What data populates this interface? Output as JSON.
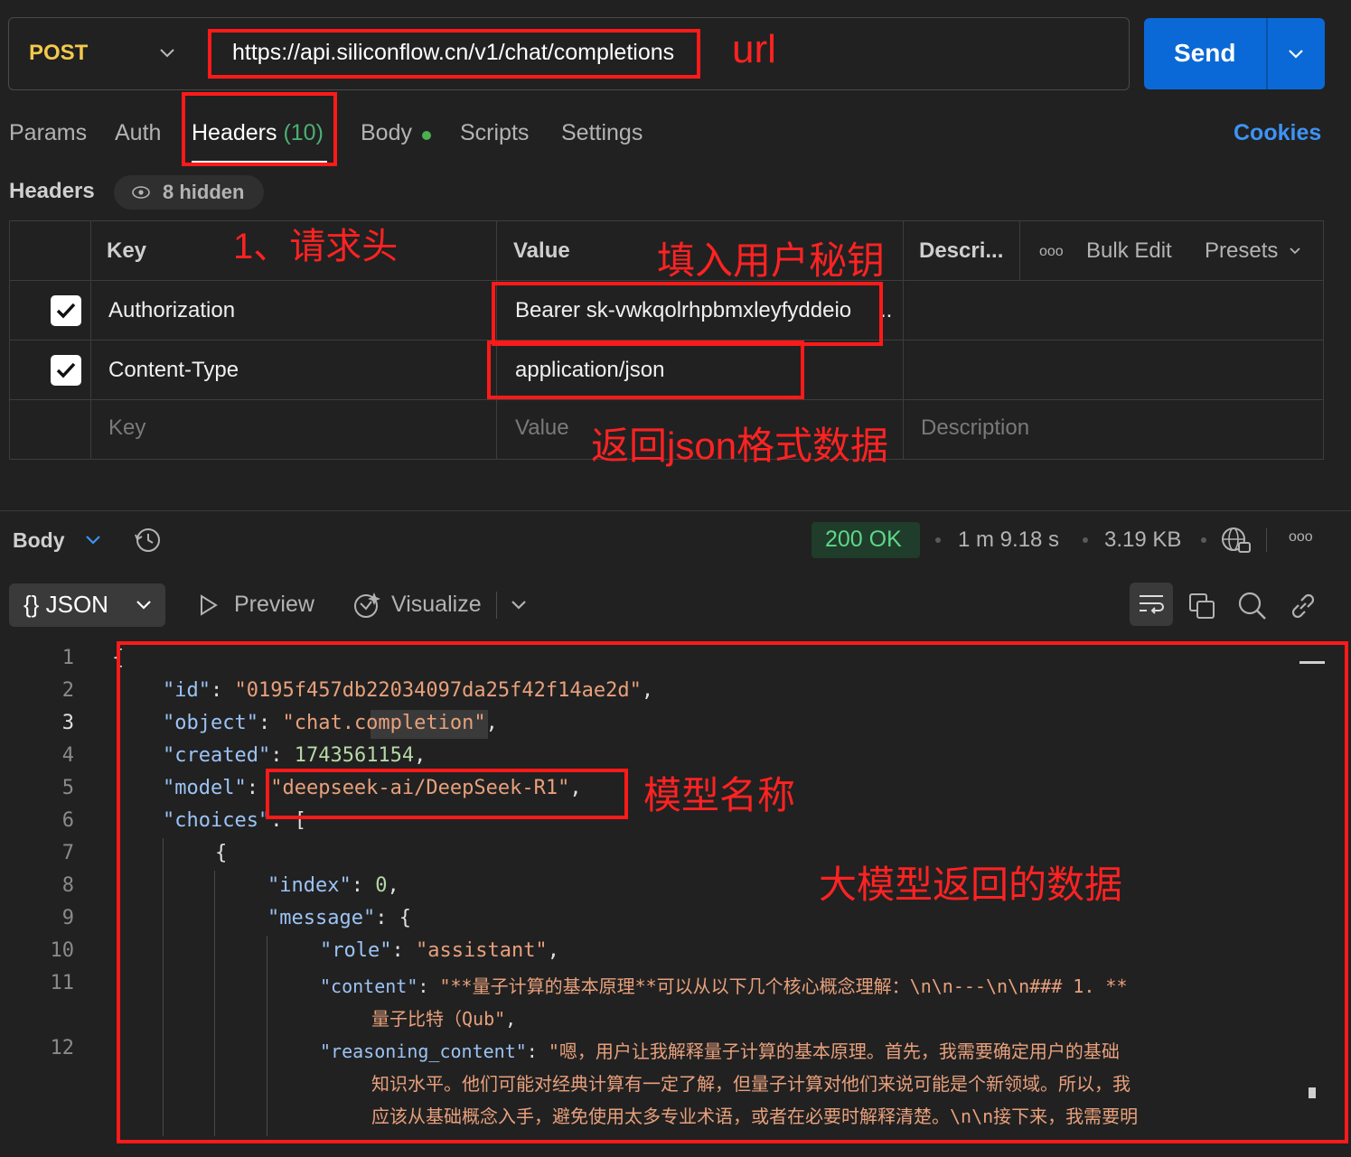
{
  "request": {
    "method": "POST",
    "url": "https://api.siliconflow.cn/v1/chat/completions",
    "send_label": "Send"
  },
  "tabs": [
    {
      "label": "Params"
    },
    {
      "label": "Auth"
    },
    {
      "label": "Headers",
      "count": "(10)"
    },
    {
      "label": "Body"
    },
    {
      "label": "Scripts"
    },
    {
      "label": "Settings"
    }
  ],
  "cookies_label": "Cookies",
  "headers_section": {
    "title": "Headers",
    "hidden": "8 hidden",
    "columns": {
      "key": "Key",
      "value": "Value",
      "description": "Descri...",
      "more": "ooo",
      "bulk_edit": "Bulk Edit",
      "presets": "Presets"
    },
    "rows": [
      {
        "checked": true,
        "key": "Authorization",
        "value": "Bearer sk-vwkqolrhpbmxleyfyddeio",
        "ellipsis": ".."
      },
      {
        "checked": true,
        "key": "Content-Type",
        "value": "application/json"
      }
    ],
    "placeholder": {
      "key": "Key",
      "value": "Value",
      "description": "Description"
    }
  },
  "annotations": {
    "url": "url",
    "headers": "1、请求头",
    "secret": "填入用户秘钥",
    "json_format": "返回json格式数据",
    "model_name": "模型名称",
    "model_data": "大模型返回的数据"
  },
  "response": {
    "body_label": "Body",
    "status": "200 OK",
    "time": "1 m 9.18 s",
    "size": "3.19 KB",
    "format": "JSON",
    "preview": "Preview",
    "visualize": "Visualize",
    "lines": [
      {
        "n": "1",
        "text": "{"
      },
      {
        "n": "2",
        "key": "\"id\"",
        "sep": ": ",
        "val": "\"0195f457db22034097da25f42f14ae2d\"",
        "end": ","
      },
      {
        "n": "3",
        "key": "\"object\"",
        "sep": ": ",
        "val": "\"chat.completion\"",
        "end": ","
      },
      {
        "n": "4",
        "key": "\"created\"",
        "sep": ": ",
        "num": "1743561154",
        "end": ","
      },
      {
        "n": "5",
        "key": "\"model\"",
        "sep": ": ",
        "val": "\"deepseek-ai/DeepSeek-R1\"",
        "end": ","
      },
      {
        "n": "6",
        "key": "\"choices\"",
        "sep": ": ",
        "end": "["
      },
      {
        "n": "7",
        "text": "{"
      },
      {
        "n": "8",
        "key": "\"index\"",
        "sep": ": ",
        "num": "0",
        "end": ","
      },
      {
        "n": "9",
        "key": "\"message\"",
        "sep": ": ",
        "end": "{"
      },
      {
        "n": "10",
        "key": "\"role\"",
        "sep": ": ",
        "val": "\"assistant\"",
        "end": ","
      },
      {
        "n": "11",
        "key": "\"content\"",
        "sep": ": ",
        "val": "\"**量子计算的基本原理**可以从以下几个核心概念理解：\\n\\n---\\n\\n### 1. **"
      },
      {
        "n": "",
        "val": "量子比特（Qub\"",
        "end": ","
      },
      {
        "n": "12",
        "key": "\"reasoning_content\"",
        "sep": ": ",
        "val": "\"嗯，用户让我解释量子计算的基本原理。首先，我需要确定用户的基础"
      },
      {
        "n": "",
        "val": "知识水平。他们可能对经典计算有一定了解，但量子计算对他们来说可能是个新领域。所以，我"
      },
      {
        "n": "",
        "val": "应该从基础概念入手，避免使用太多专业术语，或者在必要时解释清楚。\\n\\n接下来，我需要明"
      }
    ]
  },
  "colors": {
    "accent": "#0a69d6",
    "method": "#f2c94c",
    "annotation": "#ff1a1a",
    "status_ok": "#5fd68a"
  }
}
